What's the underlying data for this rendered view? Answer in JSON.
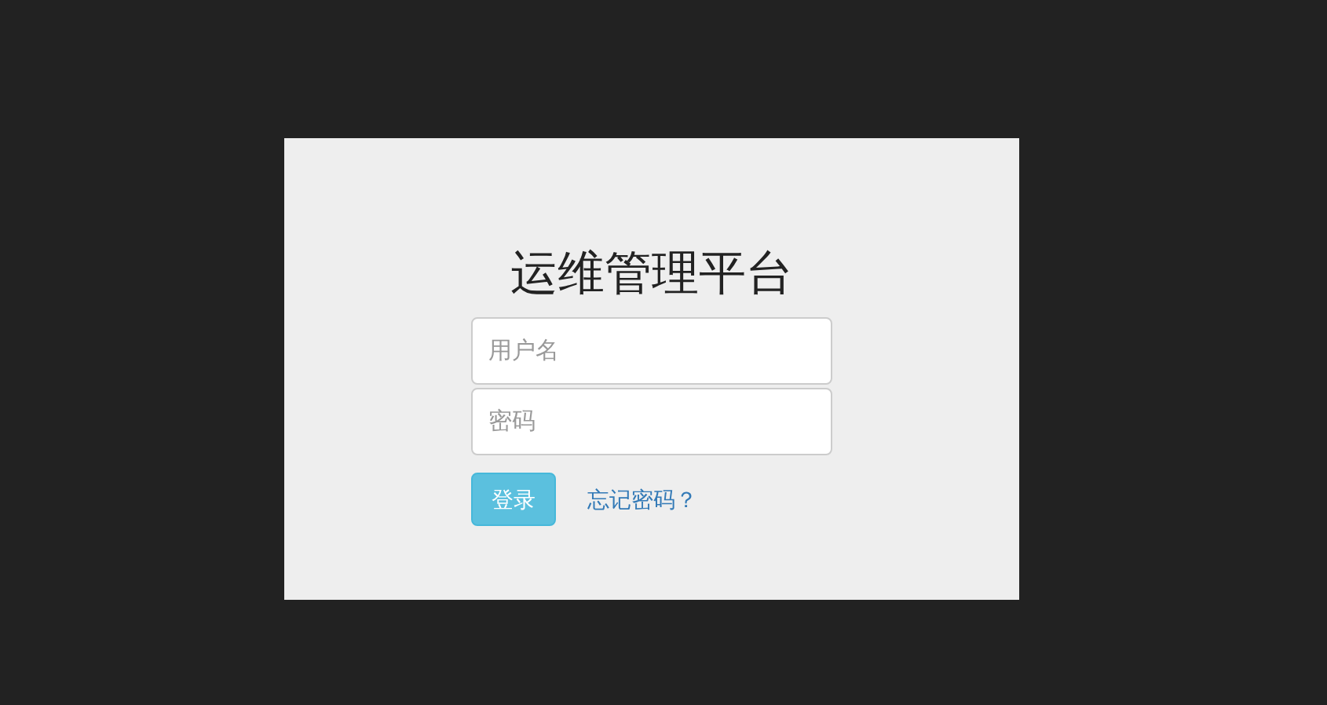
{
  "title": "运维管理平台",
  "username": {
    "placeholder": "用户名"
  },
  "password": {
    "placeholder": "密码"
  },
  "login_button": "登录",
  "forgot_link": "忘记密码？"
}
